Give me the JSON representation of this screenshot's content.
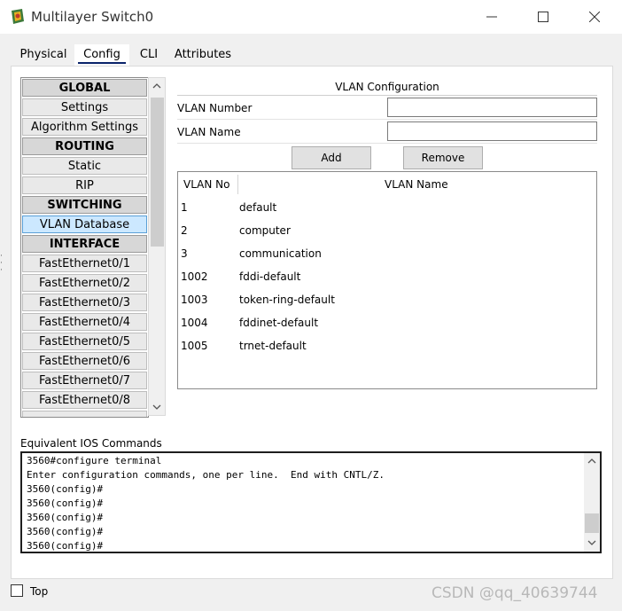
{
  "window": {
    "title": "Multilayer Switch0"
  },
  "tabs": [
    {
      "label": "Physical"
    },
    {
      "label": "Config"
    },
    {
      "label": "CLI"
    },
    {
      "label": "Attributes"
    }
  ],
  "sidebar": {
    "items": [
      {
        "label": "GLOBAL",
        "kind": "header"
      },
      {
        "label": "Settings"
      },
      {
        "label": "Algorithm Settings"
      },
      {
        "label": "ROUTING",
        "kind": "header"
      },
      {
        "label": "Static"
      },
      {
        "label": "RIP"
      },
      {
        "label": "SWITCHING",
        "kind": "header"
      },
      {
        "label": "VLAN Database",
        "selected": true
      },
      {
        "label": "INTERFACE",
        "kind": "header"
      },
      {
        "label": "FastEthernet0/1"
      },
      {
        "label": "FastEthernet0/2"
      },
      {
        "label": "FastEthernet0/3"
      },
      {
        "label": "FastEthernet0/4"
      },
      {
        "label": "FastEthernet0/5"
      },
      {
        "label": "FastEthernet0/6"
      },
      {
        "label": "FastEthernet0/7"
      },
      {
        "label": "FastEthernet0/8"
      }
    ]
  },
  "vlan_config": {
    "title": "VLAN Configuration",
    "number_label": "VLAN Number",
    "number_value": "",
    "name_label": "VLAN Name",
    "name_value": "",
    "add_label": "Add",
    "remove_label": "Remove",
    "table": {
      "headers": [
        "VLAN No",
        "VLAN Name"
      ],
      "rows": [
        {
          "no": "1",
          "name": "default"
        },
        {
          "no": "2",
          "name": "computer"
        },
        {
          "no": "3",
          "name": "communication"
        },
        {
          "no": "1002",
          "name": "fddi-default"
        },
        {
          "no": "1003",
          "name": "token-ring-default"
        },
        {
          "no": "1004",
          "name": "fddinet-default"
        },
        {
          "no": "1005",
          "name": "trnet-default"
        }
      ]
    }
  },
  "ios": {
    "label": "Equivalent IOS Commands",
    "lines": [
      "3560#configure terminal",
      "Enter configuration commands, one per line.  End with CNTL/Z.",
      "3560(config)#",
      "3560(config)#",
      "3560(config)#",
      "3560(config)#",
      "3560(config)#"
    ]
  },
  "footer": {
    "top_label": "Top",
    "top_checked": false
  },
  "watermark": "CSDN @qq_40639744",
  "colors": {
    "selected_item": "#cce8ff",
    "tab_underline": "#0a246a"
  }
}
